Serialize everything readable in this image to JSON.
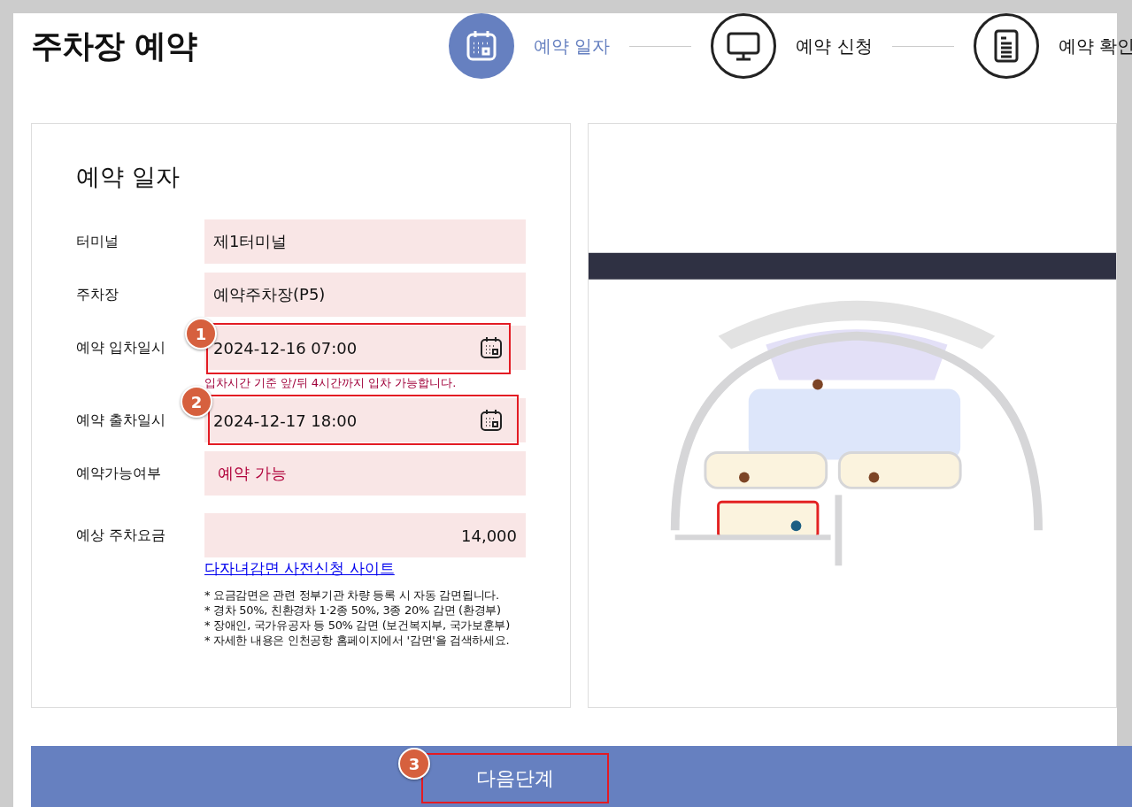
{
  "page_title": "주차장 예약",
  "steps": [
    {
      "kind": "calendar",
      "label": "예약 일자",
      "selected": true
    },
    {
      "kind": "monitor",
      "label": "예약 신청",
      "selected": false
    },
    {
      "kind": "document",
      "label": "예약 확인",
      "selected": false
    }
  ],
  "form": {
    "title": "예약 일자",
    "rows": [
      {
        "kind": "text",
        "label": "터미널",
        "value": "제1터미널",
        "highlighted": false
      },
      {
        "kind": "text",
        "label": "주차장",
        "value": "예약주차장(P5)",
        "highlighted": false
      },
      {
        "kind": "date",
        "label": "예약 입차일시",
        "value": "2024-12-16 07:00",
        "highlighted": true,
        "badge": "1",
        "hint": "입차시간 기준 앞/뒤 4시간까지 입차 가능합니다."
      },
      {
        "kind": "date",
        "label": "예약 출차일시",
        "value": "2024-12-17 18:00",
        "highlighted": true,
        "badge": "2"
      },
      {
        "kind": "status",
        "label": "예약가능여부",
        "value": "예약 가능",
        "highlighted": false
      },
      {
        "kind": "amount",
        "label": "예상 주차요금",
        "value": "14,000",
        "highlighted": false
      }
    ],
    "link": "다자녀감면 사전신청 사이트",
    "notes": [
      "* 요금감면은 관련 정부기관 차량 등록 시 자동 감면됩니다.",
      "* 경차 50%, 친환경차 1·2종 50%, 3종 20% 감면 (환경부)",
      "* 장애인, 국가유공자 등 50% 감면 (보건복지부, 국가보훈부)",
      "* 자세한 내용은 인천공항 홈페이지에서 '감면'을 검색하세요."
    ]
  },
  "next_button": {
    "label": "다음단계",
    "highlighted": true,
    "badge": "3"
  }
}
